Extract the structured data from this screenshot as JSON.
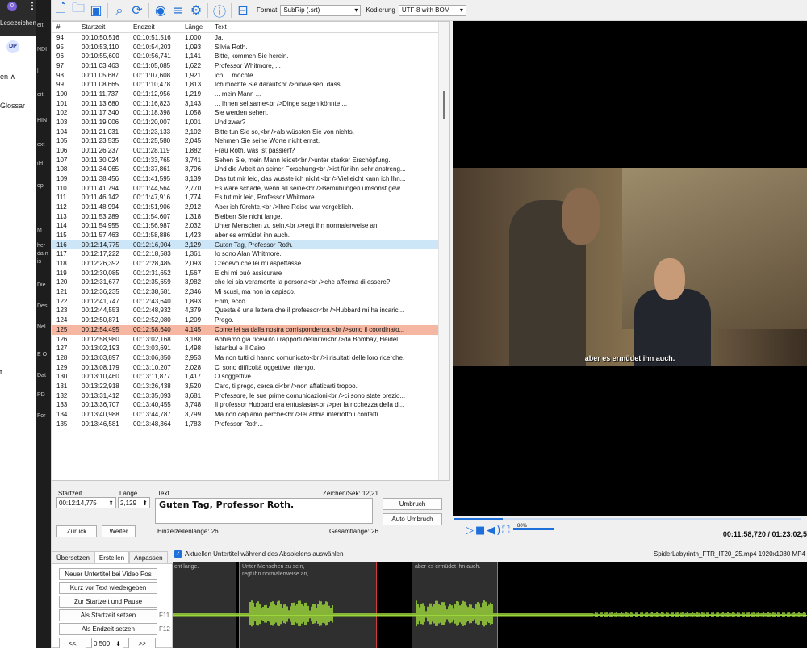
{
  "side": {
    "badge": "0",
    "dots": "⋮",
    "lesezeichen": "Lesezeichen",
    "avatar": "DP",
    "item_en": "en ∧",
    "item_glossar": "Glossar",
    "item_t": "t",
    "dark_labels": [
      "eit",
      "NDI",
      "[",
      "eit",
      "HIN",
      "ext",
      "ild",
      "op",
      "M",
      "her da n is",
      "Die",
      "Des",
      "Nel",
      "E O",
      "Dat",
      "PD",
      "For"
    ]
  },
  "toolbar": {
    "icons": [
      "new-file-icon",
      "open-folder-icon",
      "save-icon",
      "search-icon",
      "refresh-icon",
      "visibility-icon",
      "spellcheck-icon",
      "gear-icon",
      "help-icon",
      "layout-icon"
    ],
    "format_label": "Format",
    "format_value": "SubRip (.srt)",
    "encoding_label": "Kodierung",
    "encoding_value": "UTF-8 with BOM"
  },
  "list": {
    "headers": {
      "n": "#",
      "start": "Startzeit",
      "end": "Endzeit",
      "len": "Länge",
      "text": "Text"
    },
    "rows": [
      {
        "n": "94",
        "s": "00:10:50,516",
        "e": "00:10:51,516",
        "l": "1,000",
        "t": "Ja."
      },
      {
        "n": "95",
        "s": "00:10:53,110",
        "e": "00:10:54,203",
        "l": "1,093",
        "t": "Silvia Roth."
      },
      {
        "n": "96",
        "s": "00:10:55,600",
        "e": "00:10:56,741",
        "l": "1,141",
        "t": "Bitte, kommen Sie herein."
      },
      {
        "n": "97",
        "s": "00:11:03,463",
        "e": "00:11:05,085",
        "l": "1,622",
        "t": "Professor Whitmore, ..."
      },
      {
        "n": "98",
        "s": "00:11:05,687",
        "e": "00:11:07,608",
        "l": "1,921",
        "t": "ich ... möchte ..."
      },
      {
        "n": "99",
        "s": "00:11:08,665",
        "e": "00:11:10,478",
        "l": "1,813",
        "t": "Ich möchte Sie darauf<br />hinweisen, dass ..."
      },
      {
        "n": "100",
        "s": "00:11:11,737",
        "e": "00:11:12,956",
        "l": "1,219",
        "t": "... mein Mann ..."
      },
      {
        "n": "101",
        "s": "00:11:13,680",
        "e": "00:11:16,823",
        "l": "3,143",
        "t": "... Ihnen seltsame<br />Dinge sagen könnte ..."
      },
      {
        "n": "102",
        "s": "00:11:17,340",
        "e": "00:11:18,398",
        "l": "1,058",
        "t": "Sie werden sehen."
      },
      {
        "n": "103",
        "s": "00:11:19,006",
        "e": "00:11:20,007",
        "l": "1,001",
        "t": "Und zwar?"
      },
      {
        "n": "104",
        "s": "00:11:21,031",
        "e": "00:11:23,133",
        "l": "2,102",
        "t": "Bitte tun Sie so,<br />als wüssten Sie von nichts."
      },
      {
        "n": "105",
        "s": "00:11:23,535",
        "e": "00:11:25,580",
        "l": "2,045",
        "t": "Nehmen Sie seine Worte nicht ernst."
      },
      {
        "n": "106",
        "s": "00:11:26,237",
        "e": "00:11:28,119",
        "l": "1,882",
        "t": "Frau Roth, was ist passiert?"
      },
      {
        "n": "107",
        "s": "00:11:30,024",
        "e": "00:11:33,765",
        "l": "3,741",
        "t": "Sehen Sie, mein Mann leidet<br />unter starker Erschöpfung."
      },
      {
        "n": "108",
        "s": "00:11:34,065",
        "e": "00:11:37,861",
        "l": "3,796",
        "t": "Und die Arbeit an seiner Forschung<br />ist für ihn sehr anstreng..."
      },
      {
        "n": "109",
        "s": "00:11:38,456",
        "e": "00:11:41,595",
        "l": "3,139",
        "t": "Das tut mir leid, das wusste ich nicht.<br />Vielleicht kann ich Ihn..."
      },
      {
        "n": "110",
        "s": "00:11:41,794",
        "e": "00:11:44,564",
        "l": "2,770",
        "t": "Es wäre schade, wenn all seine<br />Bemühungen umsonst gew..."
      },
      {
        "n": "111",
        "s": "00:11:46,142",
        "e": "00:11:47,916",
        "l": "1,774",
        "t": "Es tut mir leid, Professor Whitmore."
      },
      {
        "n": "112",
        "s": "00:11:48,994",
        "e": "00:11:51,906",
        "l": "2,912",
        "t": "Aber ich fürchte,<br />Ihre Reise war vergeblich."
      },
      {
        "n": "113",
        "s": "00:11:53,289",
        "e": "00:11:54,607",
        "l": "1,318",
        "t": "Bleiben Sie nicht lange."
      },
      {
        "n": "114",
        "s": "00:11:54,955",
        "e": "00:11:56,987",
        "l": "2,032",
        "t": "Unter Menschen zu sein,<br />regt ihn normalerweise an,"
      },
      {
        "n": "115",
        "s": "00:11:57,463",
        "e": "00:11:58,886",
        "l": "1,423",
        "t": "aber es ermüdet ihn auch."
      },
      {
        "n": "116",
        "s": "00:12:14,775",
        "e": "00:12:16,904",
        "l": "2,129",
        "t": "Guten Tag, Professor Roth."
      },
      {
        "n": "117",
        "s": "00:12:17,222",
        "e": "00:12:18,583",
        "l": "1,361",
        "t": "Io sono Alan Whitmore."
      },
      {
        "n": "118",
        "s": "00:12:26,392",
        "e": "00:12:28,485",
        "l": "2,093",
        "t": "Credevo che lei mi aspettasse..."
      },
      {
        "n": "119",
        "s": "00:12:30,085",
        "e": "00:12:31,652",
        "l": "1,567",
        "t": "E chi mi può assicurare"
      },
      {
        "n": "120",
        "s": "00:12:31,677",
        "e": "00:12:35,659",
        "l": "3,982",
        "t": "che lei sia veramente la persona<br />che afferma di essere?"
      },
      {
        "n": "121",
        "s": "00:12:36,235",
        "e": "00:12:38,581",
        "l": "2,346",
        "t": "Mi scusi, ma non la capisco."
      },
      {
        "n": "122",
        "s": "00:12:41,747",
        "e": "00:12:43,640",
        "l": "1,893",
        "t": "Ehm, ecco..."
      },
      {
        "n": "123",
        "s": "00:12:44,553",
        "e": "00:12:48,932",
        "l": "4,379",
        "t": "Questa è una lettera che il professor<br />Hubbard mi ha incaric..."
      },
      {
        "n": "124",
        "s": "00:12:50,871",
        "e": "00:12:52,080",
        "l": "1,209",
        "t": "Prego."
      },
      {
        "n": "125",
        "s": "00:12:54,495",
        "e": "00:12:58,640",
        "l": "4,145",
        "t": "Come lei sa dalla nostra corrispondenza,<br />sono il coordinato..."
      },
      {
        "n": "126",
        "s": "00:12:58,980",
        "e": "00:13:02,168",
        "l": "3,188",
        "t": "Abbiamo già ricevuto i rapporti definitivi<br />da Bombay, Heidel..."
      },
      {
        "n": "127",
        "s": "00:13:02,193",
        "e": "00:13:03,691",
        "l": "1,498",
        "t": "Istanbul e Il Cairo."
      },
      {
        "n": "128",
        "s": "00:13:03,897",
        "e": "00:13:06,850",
        "l": "2,953",
        "t": "Ma non tutti ci hanno comunicato<br />i risultati delle loro ricerche."
      },
      {
        "n": "129",
        "s": "00:13:08,179",
        "e": "00:13:10,207",
        "l": "2,028",
        "t": "Ci sono difficoltà oggettive, ritengo."
      },
      {
        "n": "130",
        "s": "00:13:10,460",
        "e": "00:13:11,877",
        "l": "1,417",
        "t": "O soggettive."
      },
      {
        "n": "131",
        "s": "00:13:22,918",
        "e": "00:13:26,438",
        "l": "3,520",
        "t": "Caro, ti prego, cerca di<br />non affaticarti troppo."
      },
      {
        "n": "132",
        "s": "00:13:31,412",
        "e": "00:13:35,093",
        "l": "3,681",
        "t": "Professore, le sue prime comunicazioni<br />ci sono state prezio..."
      },
      {
        "n": "133",
        "s": "00:13:36,707",
        "e": "00:13:40,455",
        "l": "3,748",
        "t": "Il professor Hubbard era entusiasta<br />per la ricchezza della d..."
      },
      {
        "n": "134",
        "s": "00:13:40,988",
        "e": "00:13:44,787",
        "l": "3,799",
        "t": "Ma non capiamo perché<br />lei abbia interrotto i contatti."
      },
      {
        "n": "135",
        "s": "00:13:46,581",
        "e": "00:13:48,364",
        "l": "1,783",
        "t": "Professor Roth..."
      }
    ]
  },
  "editor": {
    "start_label": "Startzeit",
    "start_value": "00:12:14,775",
    "len_label": "Länge",
    "len_value": "2,129",
    "text_label": "Text",
    "cps": "Zeichen/Sek: 12,21",
    "text": "Guten Tag, Professor Roth.",
    "wrap": "Umbruch",
    "autowrap": "Auto Umbruch",
    "back": "Zurück",
    "next": "Weiter",
    "line_len": "Einzelzeilenlänge: 26",
    "total_len": "Gesamtlänge: 26"
  },
  "video": {
    "subtitle": "aber es ermüdet ihn auch.",
    "time": "00:11:58,720 / 01:23:02,5",
    "vol": "80%",
    "progress": 0.14
  },
  "bottom": {
    "tabs": [
      "Übersetzen",
      "Erstellen",
      "Anpassen"
    ],
    "buttons": [
      "Neuer Untertitel bei Video Pos",
      "Kurz vor Text wiedergeben",
      "Zur Startzeit und Pause",
      "Als Startzeit setzen",
      "Als Endzeit setzen"
    ],
    "keys": [
      "F11",
      "F12"
    ],
    "nav_prev": "<<",
    "nav_next": ">>",
    "step": "0,500",
    "checkbox": "Aktuellen Untertitel während des Abspielens auswählen",
    "file_info": "SpiderLabyrinth_FTR_IT20_25.mp4 1920x1080 MP4",
    "wave_caps": [
      "cht lange.",
      "Unter Menschen zu sein,\nregt ihn normalerweise an,",
      "aber es ermüdet ihn auch."
    ]
  },
  "colors": {
    "accent": "#1e6fd9",
    "selected_row": "#cde6f7",
    "highlight_row": "#f5b7a2",
    "wave": "#9bd63a"
  }
}
